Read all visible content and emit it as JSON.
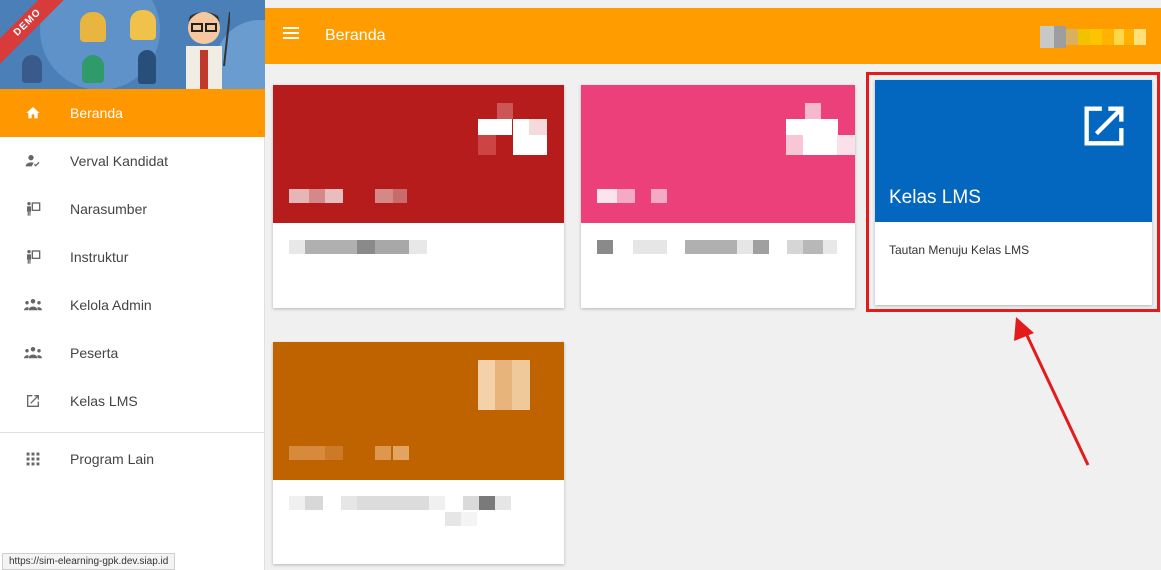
{
  "banner": {
    "ribbon": "DEMO"
  },
  "header": {
    "title": "Beranda"
  },
  "sidebar": {
    "items": [
      {
        "label": "Beranda",
        "icon": "home-icon",
        "active": true
      },
      {
        "label": "Verval Kandidat",
        "icon": "person-check-icon"
      },
      {
        "label": "Narasumber",
        "icon": "presenter-icon"
      },
      {
        "label": "Instruktur",
        "icon": "presenter-icon"
      },
      {
        "label": "Kelola Admin",
        "icon": "group-icon"
      },
      {
        "label": "Peserta",
        "icon": "group-icon"
      },
      {
        "label": "Kelas LMS",
        "icon": "open-in-new-icon"
      }
    ],
    "secondary": [
      {
        "label": "Program Lain",
        "icon": "apps-grid-icon"
      }
    ]
  },
  "cards": {
    "lms": {
      "title": "Kelas LMS",
      "description": "Tautan Menuju Kelas LMS"
    }
  },
  "status_bar": {
    "url": "https://sim-elearning-gpk.dev.siap.id"
  },
  "colors": {
    "accent": "#ff9d00",
    "card_red": "#b71c1c",
    "card_pink": "#ec407a",
    "card_blue": "#0367bf",
    "card_orange": "#bf6200",
    "highlight": "#e31b1b"
  }
}
